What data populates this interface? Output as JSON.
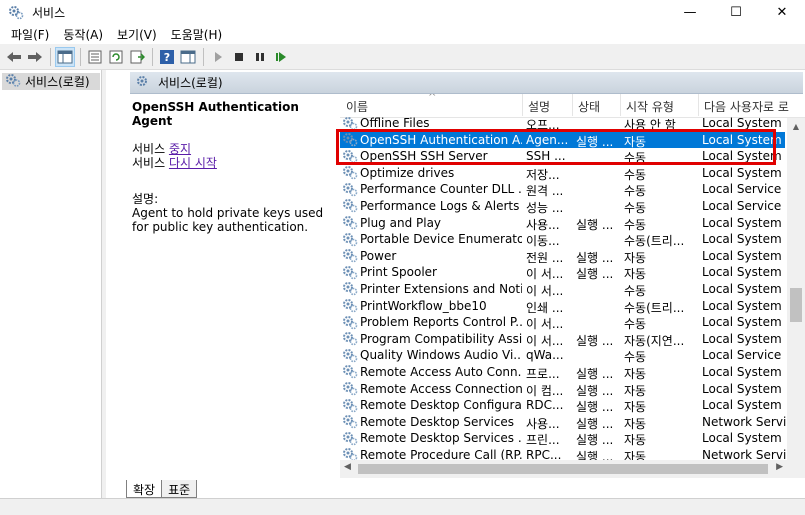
{
  "window": {
    "title": "서비스",
    "minimize": "—",
    "maximize": "☐",
    "close": "✕"
  },
  "menu": [
    "파일(F)",
    "동작(A)",
    "보기(V)",
    "도움말(H)"
  ],
  "tree": {
    "root": "서비스(로컬)"
  },
  "content_header": "서비스(로컬)",
  "detail": {
    "name": "OpenSSH Authentication Agent",
    "stop_prefix": "서비스 ",
    "stop_link": "중지",
    "restart_prefix": "서비스 ",
    "restart_link": "다시 시작",
    "desc_label": "설명:",
    "desc_text": "Agent to hold private keys used for public key authentication."
  },
  "columns": {
    "name": "이름",
    "desc": "설명",
    "status": "상태",
    "startup": "시작 유형",
    "logon": "다음 사용자로 로"
  },
  "rows": [
    {
      "name": "Offline Files",
      "desc": "오프...",
      "status": "",
      "startup": "사용 안 함",
      "logon": "Local System"
    },
    {
      "name": "OpenSSH Authentication A...",
      "desc": "Agen...",
      "status": "실행 ...",
      "startup": "자동",
      "logon": "Local System"
    },
    {
      "name": "OpenSSH SSH Server",
      "desc": "SSH ...",
      "status": "",
      "startup": "수동",
      "logon": "Local System"
    },
    {
      "name": "Optimize drives",
      "desc": "저장...",
      "status": "",
      "startup": "수동",
      "logon": "Local System"
    },
    {
      "name": "Performance Counter DLL ...",
      "desc": "원격 ...",
      "status": "",
      "startup": "수동",
      "logon": "Local Service"
    },
    {
      "name": "Performance Logs & Alerts",
      "desc": "성능 ...",
      "status": "",
      "startup": "수동",
      "logon": "Local Service"
    },
    {
      "name": "Plug and Play",
      "desc": "사용...",
      "status": "실행 ...",
      "startup": "수동",
      "logon": "Local System"
    },
    {
      "name": "Portable Device Enumerato...",
      "desc": "이동...",
      "status": "",
      "startup": "수동(트리...",
      "logon": "Local System"
    },
    {
      "name": "Power",
      "desc": "전원 ...",
      "status": "실행 ...",
      "startup": "자동",
      "logon": "Local System"
    },
    {
      "name": "Print Spooler",
      "desc": "이 서...",
      "status": "실행 ...",
      "startup": "자동",
      "logon": "Local System"
    },
    {
      "name": "Printer Extensions and Noti...",
      "desc": "이 서...",
      "status": "",
      "startup": "수동",
      "logon": "Local System"
    },
    {
      "name": "PrintWorkflow_bbe10",
      "desc": "인쇄 ...",
      "status": "",
      "startup": "수동(트리...",
      "logon": "Local System"
    },
    {
      "name": "Problem Reports Control P...",
      "desc": "이 서...",
      "status": "",
      "startup": "수동",
      "logon": "Local System"
    },
    {
      "name": "Program Compatibility Assi...",
      "desc": "이 서...",
      "status": "실행 ...",
      "startup": "자동(지연...",
      "logon": "Local System"
    },
    {
      "name": "Quality Windows Audio Vi...",
      "desc": "qWa...",
      "status": "",
      "startup": "수동",
      "logon": "Local Service"
    },
    {
      "name": "Remote Access Auto Conn...",
      "desc": "프로...",
      "status": "실행 ...",
      "startup": "자동",
      "logon": "Local System"
    },
    {
      "name": "Remote Access Connection...",
      "desc": "이 컴...",
      "status": "실행 ...",
      "startup": "자동",
      "logon": "Local System"
    },
    {
      "name": "Remote Desktop Configura...",
      "desc": "RDC...",
      "status": "실행 ...",
      "startup": "자동",
      "logon": "Local System"
    },
    {
      "name": "Remote Desktop Services",
      "desc": "사용...",
      "status": "실행 ...",
      "startup": "자동",
      "logon": "Network Service"
    },
    {
      "name": "Remote Desktop Services ...",
      "desc": "프린...",
      "status": "실행 ...",
      "startup": "자동",
      "logon": "Local System"
    },
    {
      "name": "Remote Procedure Call (RP...",
      "desc": "RPC...",
      "status": "실행 ...",
      "startup": "자동",
      "logon": "Network Service"
    }
  ],
  "selected_row": 1,
  "tabs": [
    "확장",
    "표준"
  ]
}
